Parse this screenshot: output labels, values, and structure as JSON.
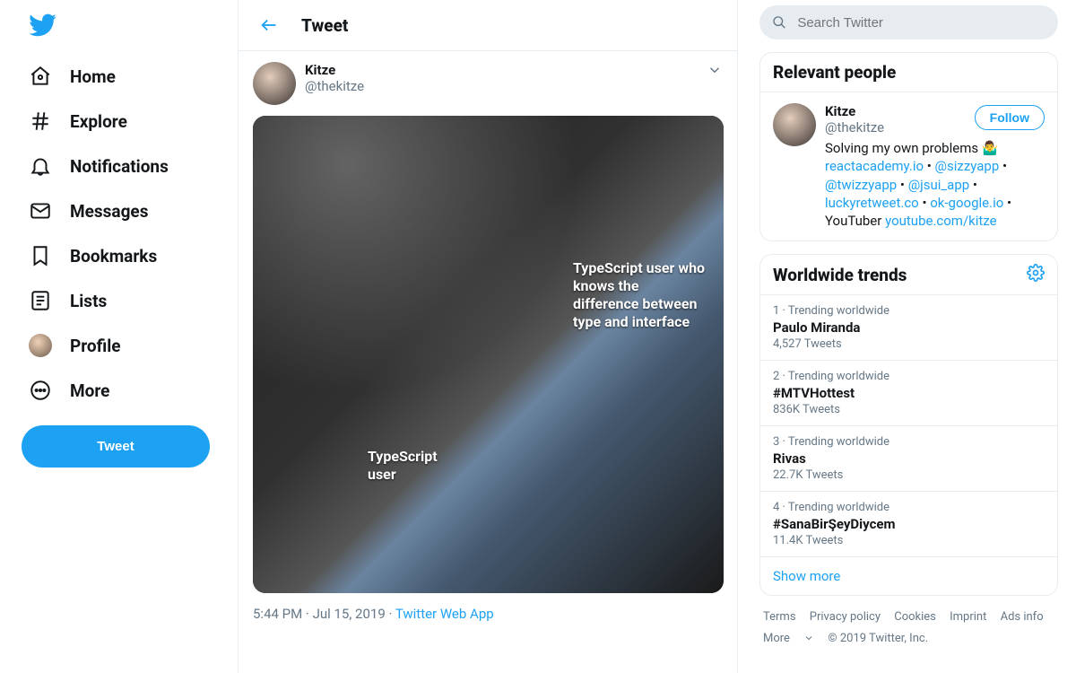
{
  "nav": {
    "items": [
      {
        "label": "Home"
      },
      {
        "label": "Explore"
      },
      {
        "label": "Notifications"
      },
      {
        "label": "Messages"
      },
      {
        "label": "Bookmarks"
      },
      {
        "label": "Lists"
      },
      {
        "label": "Profile"
      },
      {
        "label": "More"
      }
    ],
    "tweet_button": "Tweet"
  },
  "header": {
    "title": "Tweet"
  },
  "tweet": {
    "author_name": "Kitze",
    "author_handle": "@thekitze",
    "media_text_1": "TypeScript user who knows the difference between type and interface",
    "media_text_2": "TypeScript user",
    "time": "5:44 PM",
    "date": "Jul 15, 2019",
    "source": "Twitter Web App"
  },
  "search": {
    "placeholder": "Search Twitter"
  },
  "relevant": {
    "heading": "Relevant people",
    "name": "Kitze",
    "handle": "@thekitze",
    "follow": "Follow",
    "bio_plain_1": "Solving my own problems 🤷‍♂️",
    "bio_links": {
      "a": "reactacademy.io",
      "b": "@sizzyapp",
      "c": "@twizzyapp",
      "d": "@jsui_app",
      "e": "luckyretweet.co",
      "f": "ok-google.io",
      "g": "youtube.com/kitze"
    },
    "bio_youtuber": "YouTuber"
  },
  "trends": {
    "heading": "Worldwide trends",
    "items": [
      {
        "rank": "1",
        "meta": "Trending worldwide",
        "name": "Paulo Miranda",
        "count": "4,527 Tweets"
      },
      {
        "rank": "2",
        "meta": "Trending worldwide",
        "name": "#MTVHottest",
        "count": "836K Tweets"
      },
      {
        "rank": "3",
        "meta": "Trending worldwide",
        "name": "Rivas",
        "count": "22.7K Tweets"
      },
      {
        "rank": "4",
        "meta": "Trending worldwide",
        "name": "#SanaBirŞeyDiycem",
        "count": "11.4K Tweets"
      }
    ],
    "show_more": "Show more"
  },
  "footer": {
    "links": [
      "Terms",
      "Privacy policy",
      "Cookies",
      "Imprint",
      "Ads info",
      "More"
    ],
    "copyright": "© 2019 Twitter, Inc."
  }
}
